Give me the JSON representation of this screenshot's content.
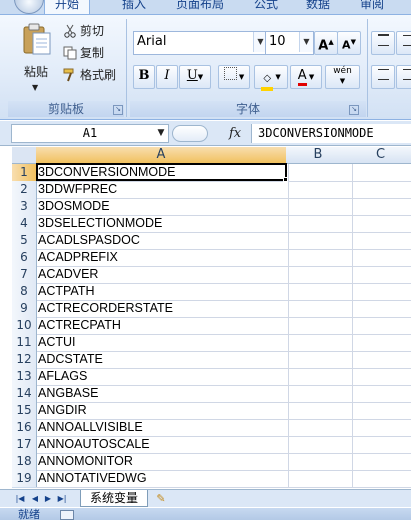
{
  "ribbon": {
    "tabs": [
      "开始",
      "插入",
      "页面布局",
      "公式",
      "数据",
      "审阅"
    ],
    "clipboard": {
      "paste": "粘贴",
      "cut": "剪切",
      "copy": "复制",
      "format_painter": "格式刷",
      "group_label": "剪贴板"
    },
    "font": {
      "name": "Arial",
      "size": "10",
      "group_label": "字体",
      "bold": "B",
      "italic": "I",
      "underline": "U",
      "grow": "A",
      "shrink": "A",
      "font_color_letter": "A",
      "phonetic": "wén"
    }
  },
  "formula_bar": {
    "name_box": "A1",
    "fx": "fx",
    "content": "3DCONVERSIONMODE"
  },
  "grid": {
    "columns": [
      "A",
      "B",
      "C"
    ],
    "rows": [
      {
        "num": "1",
        "a": "3DCONVERSIONMODE"
      },
      {
        "num": "2",
        "a": "3DDWFPREC"
      },
      {
        "num": "3",
        "a": "3DOSMODE"
      },
      {
        "num": "4",
        "a": "3DSELECTIONMODE"
      },
      {
        "num": "5",
        "a": "ACADLSPASDOC"
      },
      {
        "num": "6",
        "a": "ACADPREFIX"
      },
      {
        "num": "7",
        "a": "ACADVER"
      },
      {
        "num": "8",
        "a": "ACTPATH"
      },
      {
        "num": "9",
        "a": "ACTRECORDERSTATE"
      },
      {
        "num": "10",
        "a": "ACTRECPATH"
      },
      {
        "num": "11",
        "a": "ACTUI"
      },
      {
        "num": "12",
        "a": "ADCSTATE"
      },
      {
        "num": "13",
        "a": "AFLAGS"
      },
      {
        "num": "14",
        "a": "ANGBASE"
      },
      {
        "num": "15",
        "a": "ANGDIR"
      },
      {
        "num": "16",
        "a": "ANNOALLVISIBLE"
      },
      {
        "num": "17",
        "a": "ANNOAUTOSCALE"
      },
      {
        "num": "18",
        "a": "ANNOMONITOR"
      },
      {
        "num": "19",
        "a": "ANNOTATIVEDWG"
      }
    ]
  },
  "sheet_tabs": {
    "active": "系统变量"
  },
  "status": {
    "text": "就绪"
  }
}
